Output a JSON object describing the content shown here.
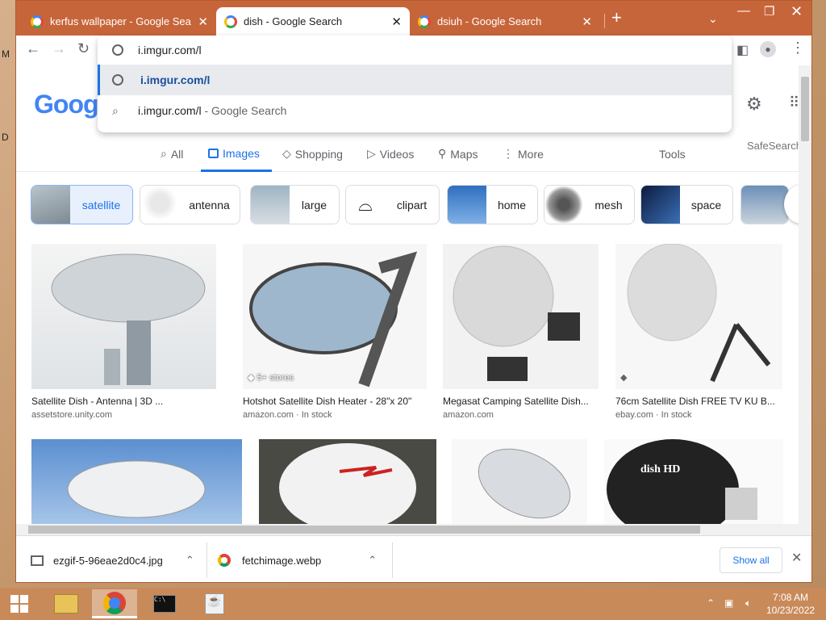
{
  "tabs": [
    {
      "title": "kerfus wallpaper - Google Search"
    },
    {
      "title": "dish - Google Search"
    },
    {
      "title": "dsiuh - Google Search"
    }
  ],
  "omnibox": {
    "input": "i.imgur.com/l",
    "suggestion_url": "i.imgur.com/l",
    "suggestion_search": "i.imgur.com/l",
    "suggestion_search_suffix": " - Google Search"
  },
  "google": {
    "logo": "Goog",
    "safesearch": "SafeSearch"
  },
  "nav": {
    "all": "All",
    "images": "Images",
    "shopping": "Shopping",
    "videos": "Videos",
    "maps": "Maps",
    "more": "More",
    "tools": "Tools"
  },
  "chips": [
    "satellite",
    "antenna",
    "large",
    "clipart",
    "home",
    "mesh",
    "space"
  ],
  "results": [
    {
      "caption": "Satellite Dish - Antenna | 3D ...",
      "source": "assetstore.unity.com"
    },
    {
      "caption": "Hotshot Satellite Dish Heater - 28\"x 20\"",
      "source": "amazon.com · In stock",
      "badge": "5+ stores"
    },
    {
      "caption": "Megasat Camping Satellite Dish...",
      "source": "amazon.com"
    },
    {
      "caption": "76cm Satellite Dish FREE TV KU B...",
      "source": "ebay.com · In stock"
    }
  ],
  "dish_logo": "dish HD",
  "downloads": {
    "file1": "ezgif-5-96eae2d0c4.jpg",
    "file2": "fetchimage.webp",
    "show_all": "Show all"
  },
  "taskbar": {
    "time": "7:08 AM",
    "date": "10/23/2022"
  }
}
